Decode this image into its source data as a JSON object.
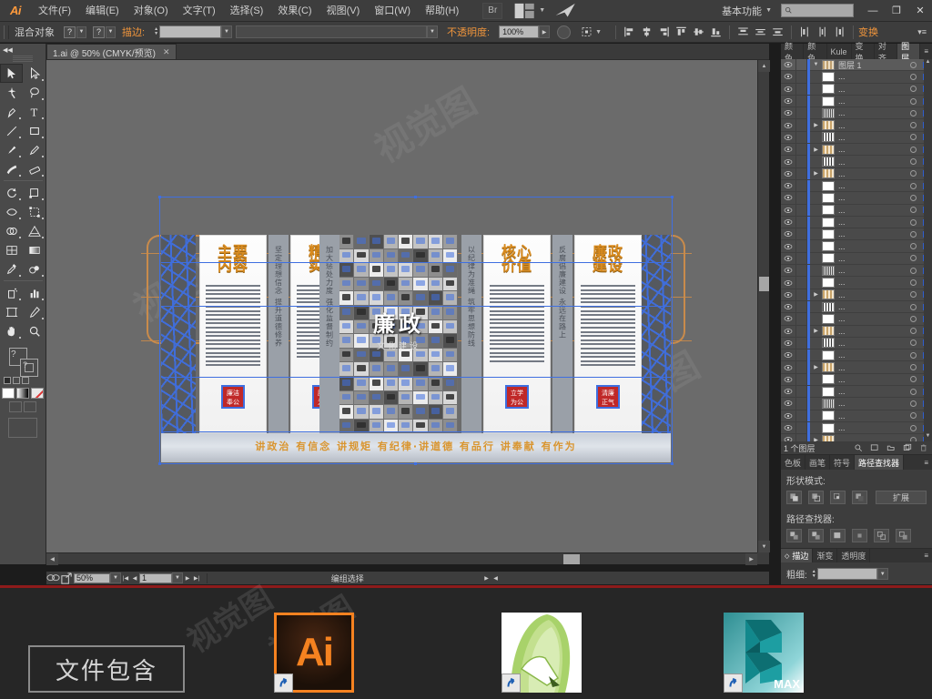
{
  "app": {
    "name": "Ai",
    "menus": [
      {
        "label": "文件(F)"
      },
      {
        "label": "编辑(E)"
      },
      {
        "label": "对象(O)"
      },
      {
        "label": "文字(T)"
      },
      {
        "label": "选择(S)"
      },
      {
        "label": "效果(C)"
      },
      {
        "label": "视图(V)"
      },
      {
        "label": "窗口(W)"
      },
      {
        "label": "帮助(H)"
      }
    ],
    "bridge_label": "Br",
    "arrange_label": "▤",
    "workspace": "基本功能",
    "search_placeholder": "",
    "window_buttons": {
      "minimize": "—",
      "maximize": "❐",
      "close": "✕"
    }
  },
  "control_bar": {
    "object_label": "混合对象",
    "fill_swatch": "?",
    "stroke_swatch": "?",
    "stroke_label": "描边:",
    "stroke_weight": "",
    "profile": "",
    "opacity_label": "不透明度:",
    "opacity_value": "100%",
    "transform_label": "变换",
    "align_icons": [
      "align-left",
      "align-center-h",
      "align-right",
      "align-top",
      "align-middle-v",
      "align-bottom",
      "distribute-top",
      "distribute-center-v",
      "distribute-bottom",
      "distribute-left",
      "distribute-center-h",
      "distribute-right"
    ]
  },
  "toolbox": {
    "tools": [
      "selection-tool",
      "direct-selection-tool",
      "magic-wand-tool",
      "lasso-tool",
      "pen-tool",
      "type-tool",
      "line-segment-tool",
      "rectangle-tool",
      "paintbrush-tool",
      "pencil-tool",
      "blob-brush-tool",
      "eraser-tool",
      "rotate-tool",
      "scale-tool",
      "width-tool",
      "free-transform-tool",
      "shape-builder-tool",
      "perspective-grid-tool",
      "mesh-tool",
      "gradient-tool",
      "eyedropper-tool",
      "blend-tool",
      "symbol-sprayer-tool",
      "column-graph-tool",
      "artboard-tool",
      "slice-tool",
      "hand-tool",
      "zoom-tool"
    ],
    "fill_label": "填色",
    "stroke_label": "描边",
    "swatches": [
      "swatch-white",
      "swatch-gradient",
      "swatch-none"
    ],
    "screen_modes": [
      "screen-mode-normal",
      "screen-mode-full"
    ]
  },
  "document": {
    "tab_title": "1.ai @ 50% (CMYK/预览)",
    "tab_close": "✕"
  },
  "artwork": {
    "banner_text": "讲政治  有信念  讲规矩  有纪律·讲道德  有品行  讲奉献  有作为",
    "center_title": "廉政",
    "center_subtitle": "文化建设",
    "panels": [
      {
        "title_line1": "主要",
        "title_line2": "内容",
        "seal_line1": "廉洁",
        "seal_line2": "奉公"
      },
      {
        "title_line1": "精神",
        "title_line2": "实质",
        "seal_line1": "廉政",
        "seal_line2": "为民"
      },
      {
        "title_line1": "核心",
        "title_line2": "价值",
        "seal_line1": "立学",
        "seal_line2": "为公"
      },
      {
        "title_line1": "廉政",
        "title_line2": "建设",
        "seal_line1": "清廉",
        "seal_line2": "正气"
      }
    ],
    "vertical_bands": [
      "坚定理想信念 提升道德修养",
      "加大惩处力度 强化监督制约",
      "以纪律为准绳 筑牢思想防线",
      "反腐倡廉建设 永远在路上"
    ],
    "watermarks": [
      "视觉图",
      "视觉图",
      "视觉图"
    ]
  },
  "status_bar": {
    "zoom": "50%",
    "page": "1",
    "status_text": "编组选择",
    "prev": "◀",
    "next": "▶"
  },
  "right_panels": {
    "top_tabs": [
      {
        "label": "颜色",
        "active": false
      },
      {
        "label": "颜色",
        "active": false
      },
      {
        "label": "Kule",
        "active": false
      },
      {
        "label": "变换",
        "active": false
      },
      {
        "label": "对齐",
        "active": false
      },
      {
        "label": "图层",
        "active": true
      }
    ],
    "panel_menu": "≡",
    "layers": {
      "root_name": "图层 1",
      "sublayer_placeholder": "...",
      "rows": [
        {
          "thumb": "white",
          "expandable": false
        },
        {
          "thumb": "white",
          "expandable": false
        },
        {
          "thumb": "white",
          "expandable": false
        },
        {
          "thumb": "hatch",
          "expandable": false
        },
        {
          "thumb": "grid-tan",
          "expandable": true
        },
        {
          "thumb": "grid-dark",
          "expandable": false
        },
        {
          "thumb": "grid-tan",
          "expandable": true
        },
        {
          "thumb": "grid-dark",
          "expandable": false
        },
        {
          "thumb": "grid-tan",
          "expandable": true
        },
        {
          "thumb": "white",
          "expandable": false
        },
        {
          "thumb": "white",
          "expandable": false
        },
        {
          "thumb": "white",
          "expandable": false
        },
        {
          "thumb": "white",
          "expandable": false
        },
        {
          "thumb": "white",
          "expandable": false
        },
        {
          "thumb": "white",
          "expandable": false
        },
        {
          "thumb": "white",
          "expandable": false
        },
        {
          "thumb": "hatch",
          "expandable": false
        },
        {
          "thumb": "white",
          "expandable": false
        },
        {
          "thumb": "grid-tan",
          "expandable": true
        },
        {
          "thumb": "grid-dark",
          "expandable": false
        },
        {
          "thumb": "white",
          "expandable": false
        },
        {
          "thumb": "grid-tan",
          "expandable": true
        },
        {
          "thumb": "grid-dark",
          "expandable": false
        },
        {
          "thumb": "white",
          "expandable": false
        },
        {
          "thumb": "grid-tan",
          "expandable": true
        },
        {
          "thumb": "white",
          "expandable": false
        },
        {
          "thumb": "white",
          "expandable": false
        },
        {
          "thumb": "hatch",
          "expandable": false
        },
        {
          "thumb": "white",
          "expandable": false
        },
        {
          "thumb": "white",
          "expandable": false
        },
        {
          "thumb": "grid-tan",
          "expandable": true
        },
        {
          "thumb": "white",
          "expandable": false
        },
        {
          "thumb": "white",
          "expandable": false
        },
        {
          "thumb": "white",
          "expandable": false
        },
        {
          "thumb": "white",
          "expandable": false
        }
      ],
      "footer_count": "1 个图层",
      "footer_icons": [
        "locate-object-icon",
        "make-clipping-mask-icon",
        "new-sublayer-icon",
        "new-layer-icon",
        "delete-layer-icon"
      ]
    },
    "pathfinder": {
      "tabs": [
        {
          "label": "色板",
          "active": false
        },
        {
          "label": "画笔",
          "active": false
        },
        {
          "label": "符号",
          "active": false
        },
        {
          "label": "路径查找器",
          "active": true
        }
      ],
      "shape_modes_label": "形状模式:",
      "expand_label": "扩展",
      "pathfinders_label": "路径查找器:",
      "shape_mode_icons": [
        "unite-icon",
        "minus-front-icon",
        "intersect-icon",
        "exclude-icon"
      ],
      "pathfinder_icons": [
        "divide-icon",
        "trim-icon",
        "merge-icon",
        "crop-icon",
        "outline-icon",
        "minus-back-icon"
      ]
    },
    "stroke": {
      "tabs": [
        {
          "label": "描边",
          "active": true
        },
        {
          "label": "渐变",
          "active": false
        },
        {
          "label": "透明度",
          "active": false
        }
      ],
      "weight_label": "粗细:",
      "weight_value": ""
    }
  },
  "dock": {
    "file_tag": "文件包含",
    "apps": [
      {
        "name": "Adobe Illustrator",
        "glyph": "Ai"
      },
      {
        "name": "CorelDRAW",
        "glyph": ""
      },
      {
        "name": "3ds Max",
        "glyph": "MAX"
      }
    ]
  }
}
